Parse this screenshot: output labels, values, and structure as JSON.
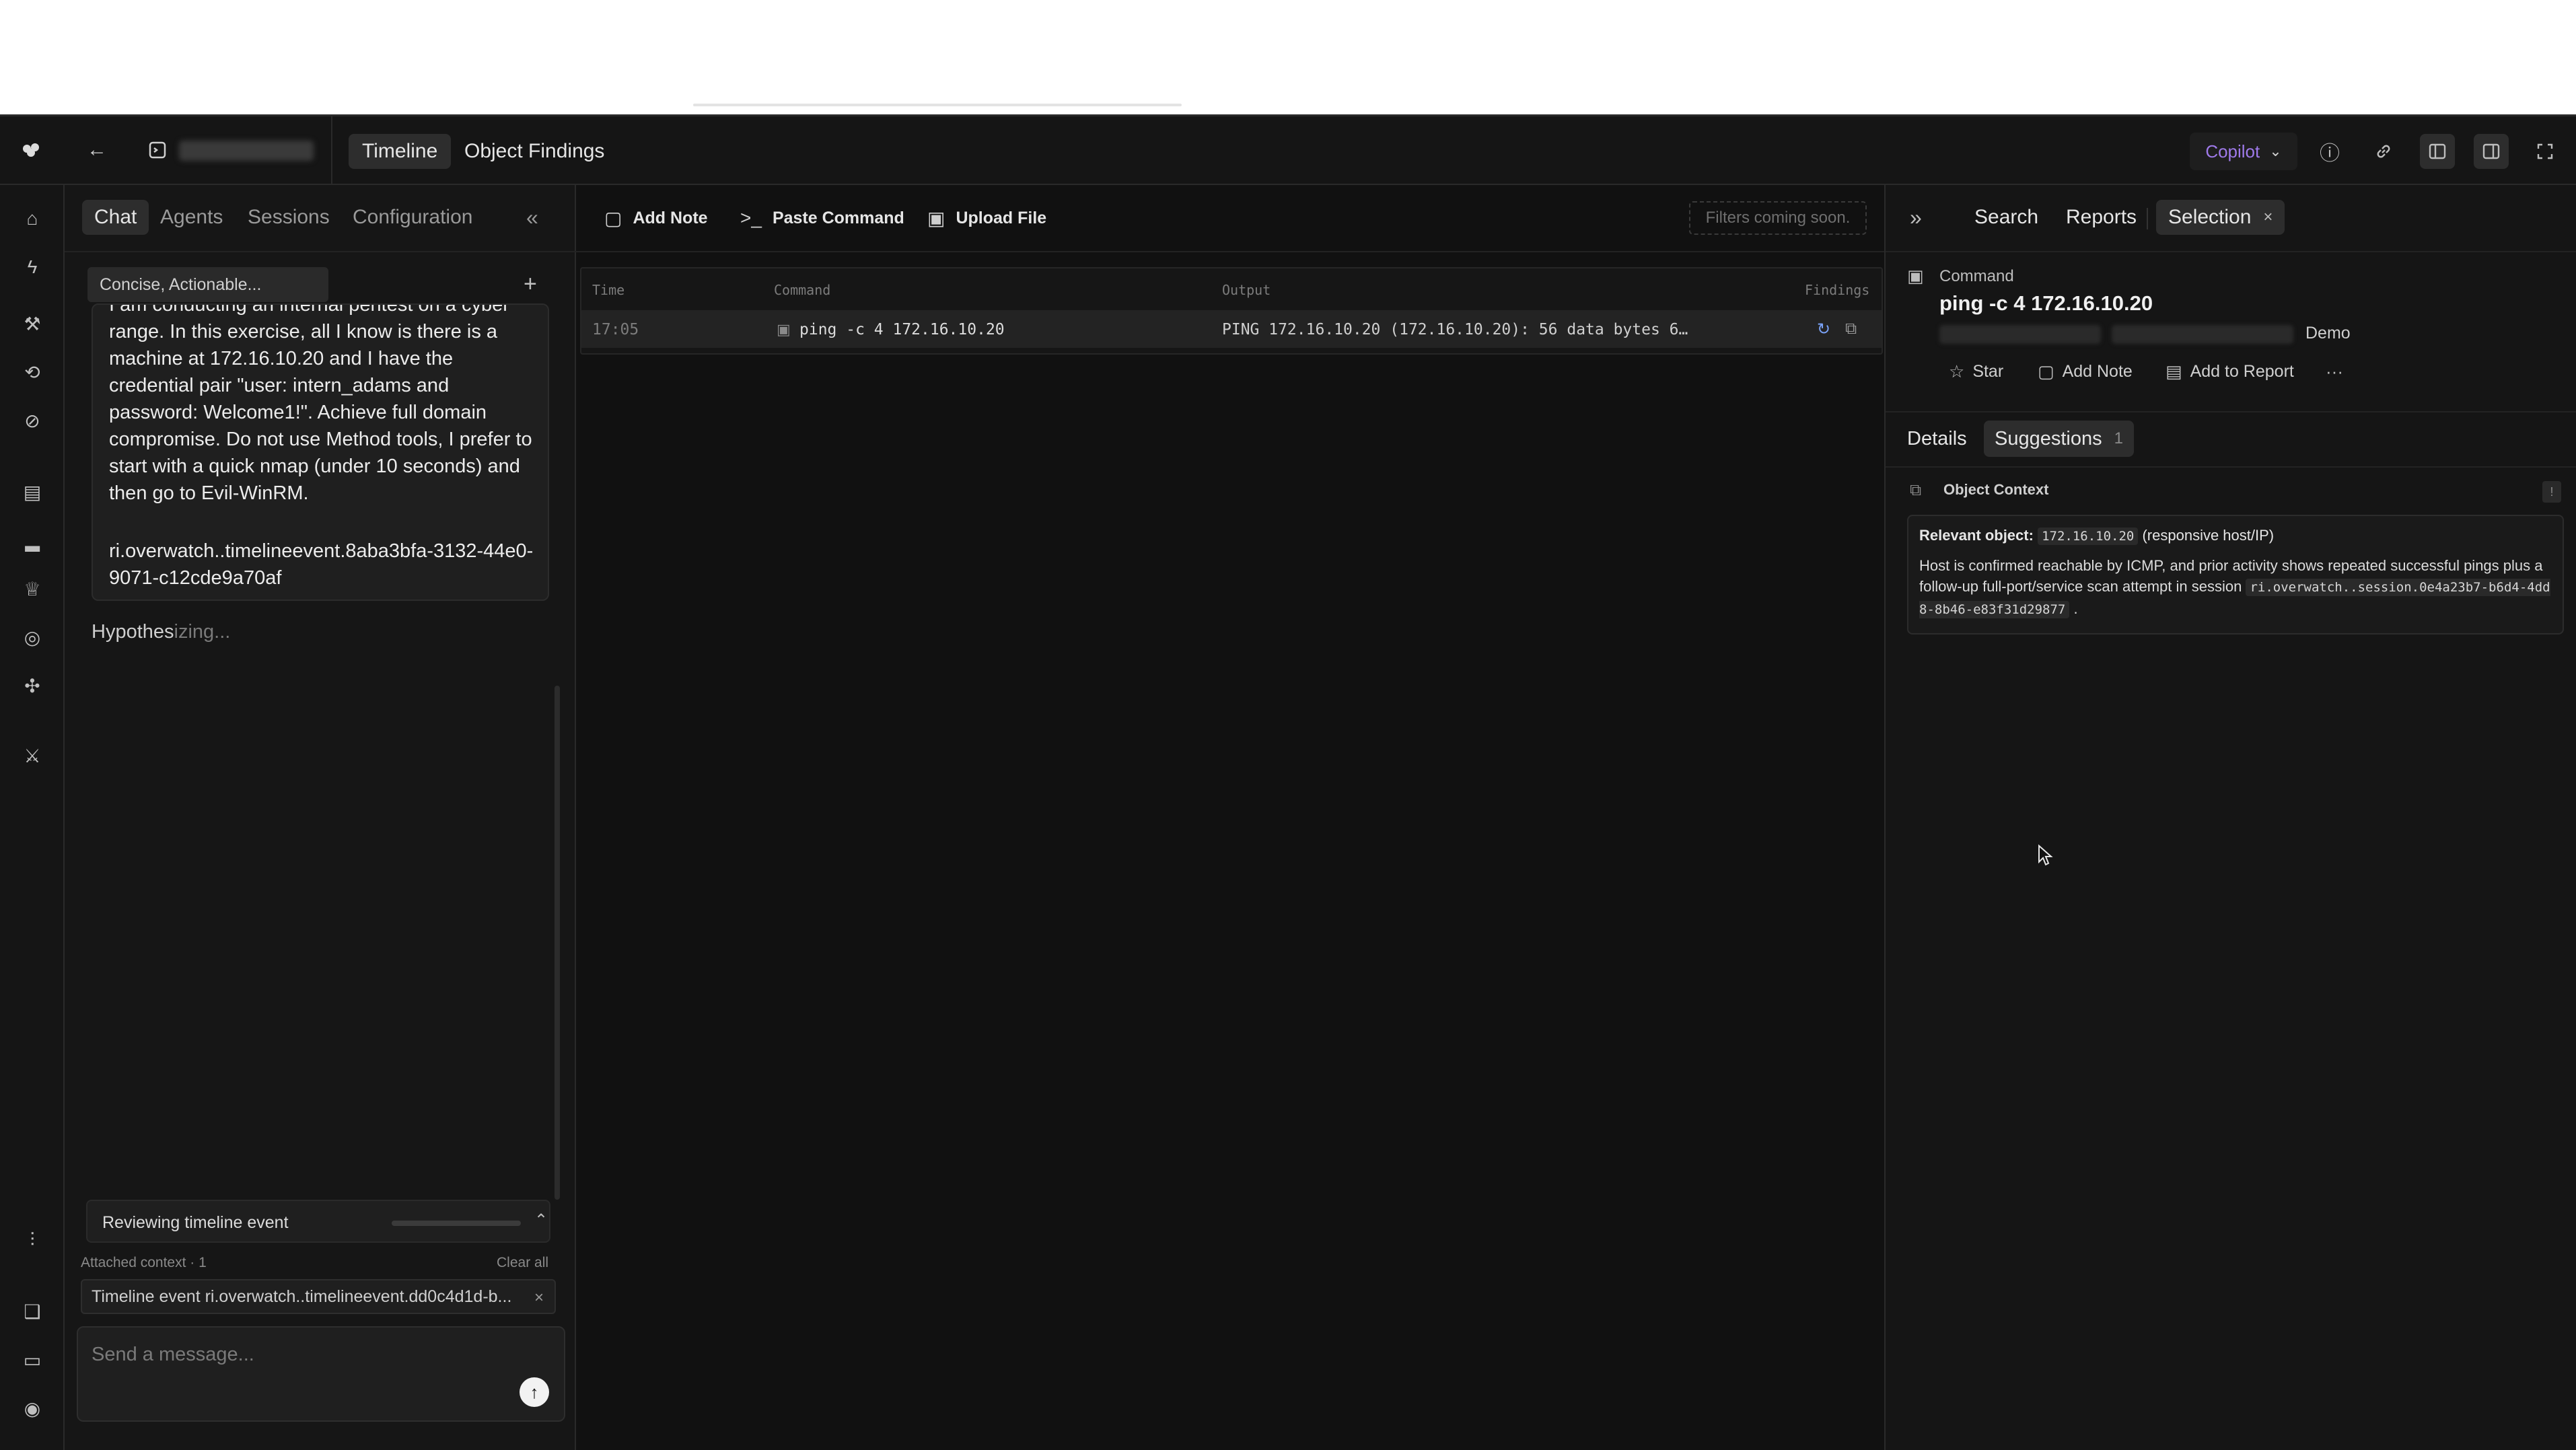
{
  "app": {
    "workspace_name": "",
    "view_tabs": [
      "Timeline",
      "Object Findings"
    ],
    "copilot_label": "Copilot"
  },
  "chat": {
    "tabs": [
      "Chat",
      "Agents",
      "Sessions",
      "Configuration"
    ],
    "mode": "Concise, Actionable...",
    "message": "I am conducting an internal pentest on a cyber range. In this exercise, all I know is there is a machine at 172.16.10.20 and I have the credential pair \"user: intern_adams and password: Welcome1!\". Achieve full domain compromise. Do not use Method tools, I prefer to start with a quick nmap (under 10 seconds) and then go to Evil-WinRM.",
    "message_ref": "ri.overwatch..timelineevent.8aba3bfa-3132-44e0-9071-c12cde9a70af",
    "status_prefix": "Hypothes",
    "status_suffix": "izing...",
    "review_label": "Reviewing timeline event",
    "attached_label": "Attached context · 1",
    "clear_all": "Clear all",
    "context_chip": "Timeline event ri.overwatch..timelineevent.dd0c4d1d-b...",
    "composer_placeholder": "Send a message..."
  },
  "timeline": {
    "toolbar": [
      "Add Note",
      "Paste Command",
      "Upload File"
    ],
    "filter_placeholder": "Filters coming soon.",
    "columns": [
      "Time",
      "Command",
      "Output",
      "Findings"
    ],
    "rows": [
      {
        "time": "17:05",
        "command": "ping -c 4 172.16.10.20",
        "output": "PING 172.16.10.20 (172.16.10.20): 56 data bytes 6…"
      }
    ]
  },
  "side": {
    "tabs": [
      "Search",
      "Reports",
      "Selection"
    ],
    "object_kind": "Command",
    "object_title": "ping -c 4 172.16.10.20",
    "object_tag": "Demo",
    "actions": [
      "Star",
      "Add Note",
      "Add to Report"
    ],
    "detail_tabs": [
      "Details",
      "Suggestions"
    ],
    "suggestions_count": "1",
    "context_title": "Object Context",
    "context_badge": "!",
    "relevant_label": "Relevant object:",
    "relevant_ip": "172.16.10.20",
    "relevant_note": "(responsive host/IP)",
    "context_body": "Host is confirmed reachable by ICMP, and prior activity shows repeated successful pings plus a follow-up full-port/service scan attempt in session",
    "context_session": "ri.overwatch..session.0e4a23b7-b6d4-4dd8-8b46-e83f31d29877",
    "context_end": "."
  },
  "icons": {
    "logo": "app-logo-icon",
    "back": "arrow-left-icon",
    "terminal": "terminal-icon",
    "info": "info-icon",
    "link": "link-icon",
    "panel_left": "panel-left-icon",
    "panel_right": "panel-right-icon",
    "fullscreen": "expand-icon"
  }
}
